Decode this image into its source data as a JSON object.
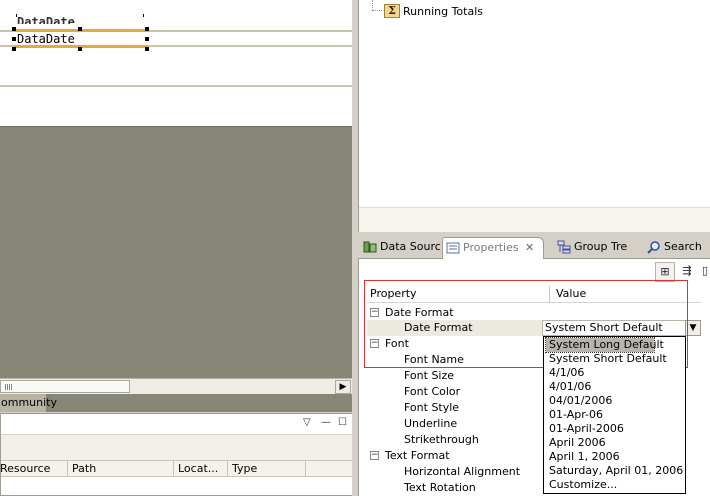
{
  "editor": {
    "field_text": "DataDate",
    "ghost_text": "DataDate"
  },
  "bottom_left": {
    "status_tab": "ommunity",
    "toolbar_glyphs": [
      "▽",
      "—",
      "☐"
    ],
    "columns": [
      "Resource",
      "Path",
      "Locat...",
      "Type"
    ]
  },
  "outline": {
    "items": [
      {
        "label": "Running Totals",
        "icon": "sigma-icon"
      }
    ]
  },
  "tabs": [
    {
      "label": "Data Sourc",
      "icon": "data-source-icon",
      "active": false
    },
    {
      "label": "Properties",
      "icon": "properties-icon",
      "active": true,
      "close": "✕"
    },
    {
      "label": "Group Tre",
      "icon": "group-tree-icon",
      "active": false
    },
    {
      "label": "Search",
      "icon": "search-icon",
      "active": false
    }
  ],
  "properties": {
    "header": {
      "property": "Property",
      "value": "Value"
    },
    "rows": [
      {
        "label": "Date Format",
        "group": true,
        "expander": "−"
      },
      {
        "label": "Date Format",
        "group": false
      },
      {
        "label": "Font",
        "group": true,
        "expander": "−"
      },
      {
        "label": "Font Name",
        "group": false
      },
      {
        "label": "Font Size",
        "group": false
      },
      {
        "label": "Font Color",
        "group": false
      },
      {
        "label": "Font Style",
        "group": false
      },
      {
        "label": "Underline",
        "group": false
      },
      {
        "label": "Strikethrough",
        "group": false
      },
      {
        "label": "Text Format",
        "group": true,
        "expander": "−"
      },
      {
        "label": "Horizontal Alignment",
        "group": false
      },
      {
        "label": "Text Rotation",
        "group": false
      }
    ],
    "current_value": "System Short Default"
  },
  "dropdown": {
    "options": [
      "System Long Default",
      "System Short Default",
      "4/1/06",
      "4/01/06",
      "04/01/2006",
      "01-Apr-06",
      "01-April-2006",
      "April 2006",
      "April 1, 2006",
      "Saturday, April 01, 2006",
      "Customize..."
    ],
    "highlighted_index": 0
  },
  "colors": {
    "accent_red": "#e03030",
    "field_orange": "#e8a840",
    "canvas_gray": "#878778"
  }
}
